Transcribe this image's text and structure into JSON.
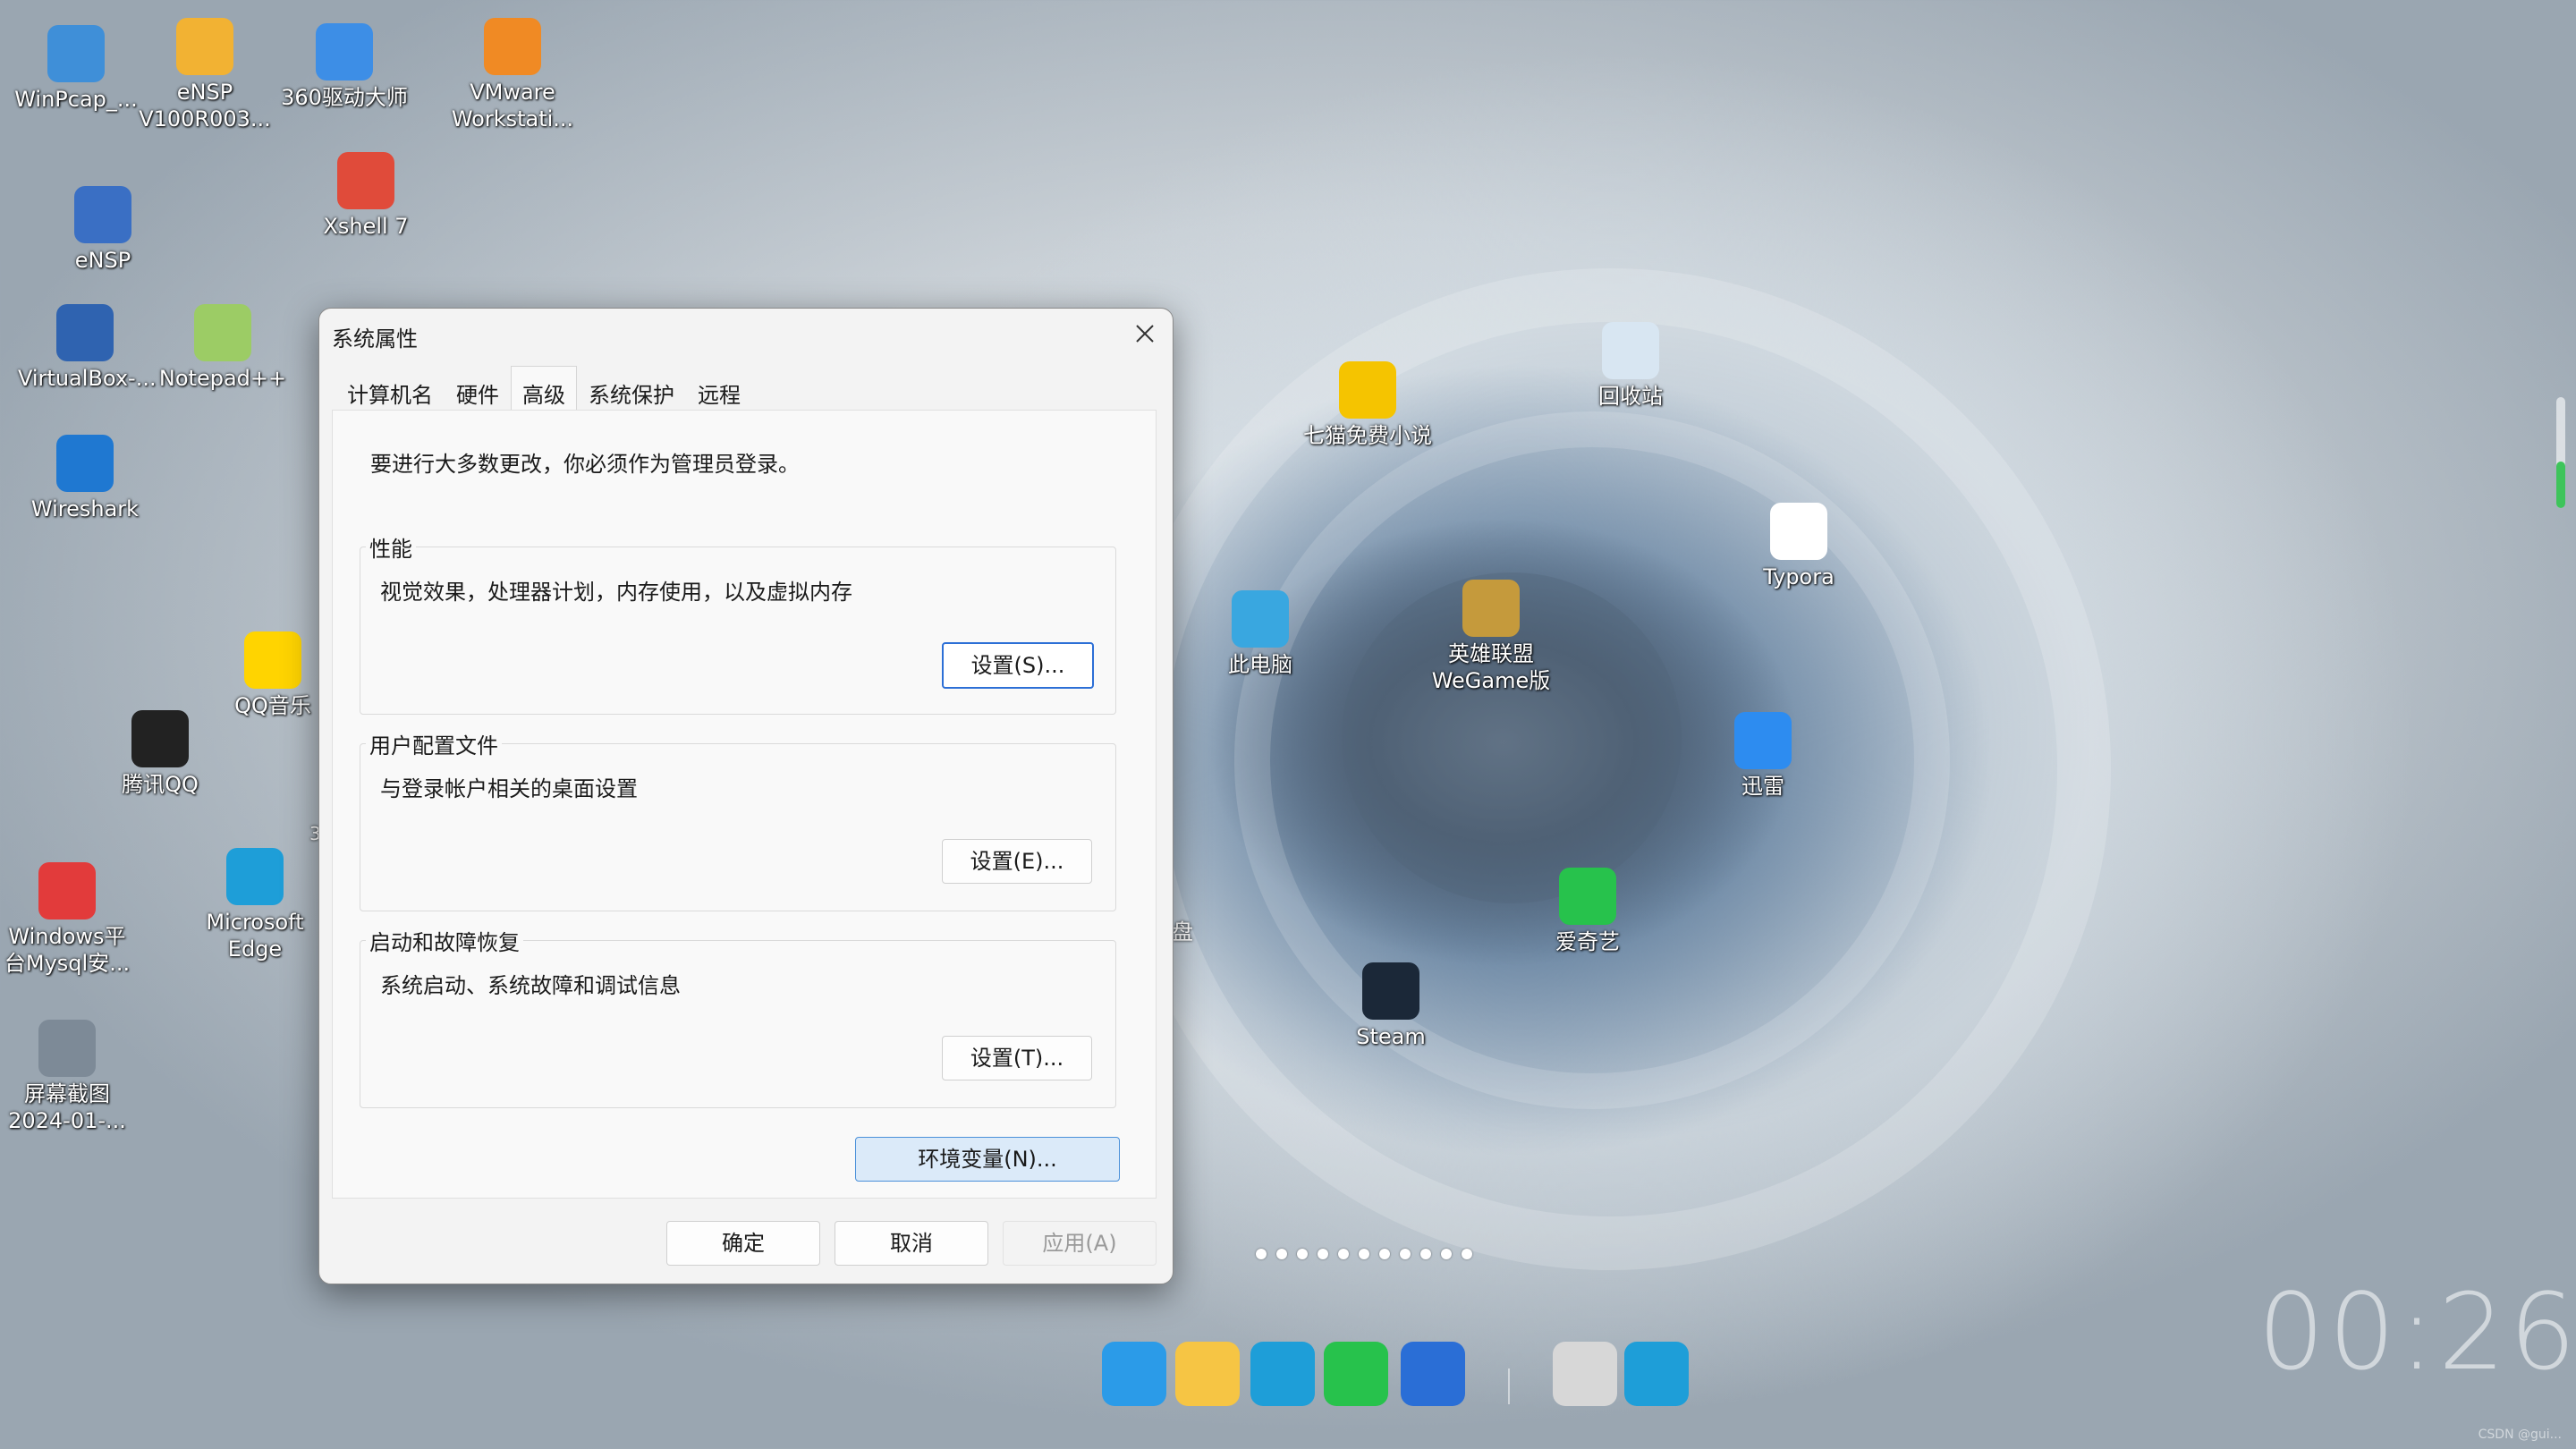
{
  "desktop": {
    "icons": [
      {
        "name": "winpcap",
        "label": "WinPcap_...",
        "icon": "globe-installer-icon"
      },
      {
        "name": "ensp-v100",
        "label": "eNSP\nV100R003...",
        "icon": "archive-icon"
      },
      {
        "name": "360-driver",
        "label": "360驱动大师",
        "icon": "gear-shield-icon"
      },
      {
        "name": "vmware",
        "label": "VMware\nWorkstati...",
        "icon": "vmware-icon"
      },
      {
        "name": "xshell",
        "label": "Xshell 7",
        "icon": "shell-icon"
      },
      {
        "name": "ensp",
        "label": "eNSP",
        "icon": "network-icon"
      },
      {
        "name": "virtualbox",
        "label": "VirtualBox-...",
        "icon": "cube-icon"
      },
      {
        "name": "notepadpp",
        "label": "Notepad++",
        "icon": "notepad-icon"
      },
      {
        "name": "wireshark",
        "label": "Wireshark",
        "icon": "fin-icon"
      },
      {
        "name": "qqmusic",
        "label": "QQ音乐",
        "icon": "music-icon"
      },
      {
        "name": "qq",
        "label": "腾讯QQ",
        "icon": "penguin-icon"
      },
      {
        "name": "windows-mysql",
        "label": "Windows平\n台Mysql安...",
        "icon": "pdf-icon"
      },
      {
        "name": "edge",
        "label": "Microsoft\nEdge",
        "icon": "edge-icon"
      },
      {
        "name": "screenshot",
        "label": "屏幕截图\n2024-01-...",
        "icon": "image-icon"
      },
      {
        "name": "qimao",
        "label": "七猫免费小说",
        "icon": "cat-book-icon"
      },
      {
        "name": "recycle-bin",
        "label": "回收站",
        "icon": "recycle-bin-icon"
      },
      {
        "name": "typora",
        "label": "Typora",
        "icon": "typora-icon"
      },
      {
        "name": "this-pc",
        "label": "此电脑",
        "icon": "monitor-icon"
      },
      {
        "name": "lol",
        "label": "英雄联盟\nWeGame版",
        "icon": "game-icon"
      },
      {
        "name": "xunlei",
        "label": "迅雷",
        "icon": "bird-icon"
      },
      {
        "name": "iqiyi",
        "label": "爱奇艺",
        "icon": "iqiyi-icon"
      },
      {
        "name": "steam",
        "label": "Steam",
        "icon": "steam-icon"
      }
    ],
    "partial_labels": {
      "pan": "盘",
      "three": "3"
    },
    "clock": "00:26",
    "watermark": "CSDN @gui..."
  },
  "dialog": {
    "title": "系统属性",
    "tabs": [
      "计算机名",
      "硬件",
      "高级",
      "系统保护",
      "远程"
    ],
    "active_tab": "高级",
    "notice": "要进行大多数更改，你必须作为管理员登录。",
    "groups": [
      {
        "title": "性能",
        "desc": "视觉效果，处理器计划，内存使用，以及虚拟内存",
        "button": "设置(S)..."
      },
      {
        "title": "用户配置文件",
        "desc": "与登录帐户相关的桌面设置",
        "button": "设置(E)..."
      },
      {
        "title": "启动和故障恢复",
        "desc": "系统启动、系统故障和调试信息",
        "button": "设置(T)..."
      }
    ],
    "env_button": "环境变量(N)...",
    "ok": "确定",
    "cancel": "取消",
    "apply": "应用(A)"
  },
  "taskbar": {
    "icons": [
      "windows-start-icon",
      "lightbulb-icon",
      "edge-icon",
      "iqiyi-icon",
      "screen-capture-icon",
      "notepad-icon",
      "edge-icon"
    ]
  },
  "page_dots": 11,
  "colors": {
    "accent": "#2c6fd6",
    "env_button_bg": "#dbeaf9",
    "scroll_indicator": "#3ec45b"
  }
}
